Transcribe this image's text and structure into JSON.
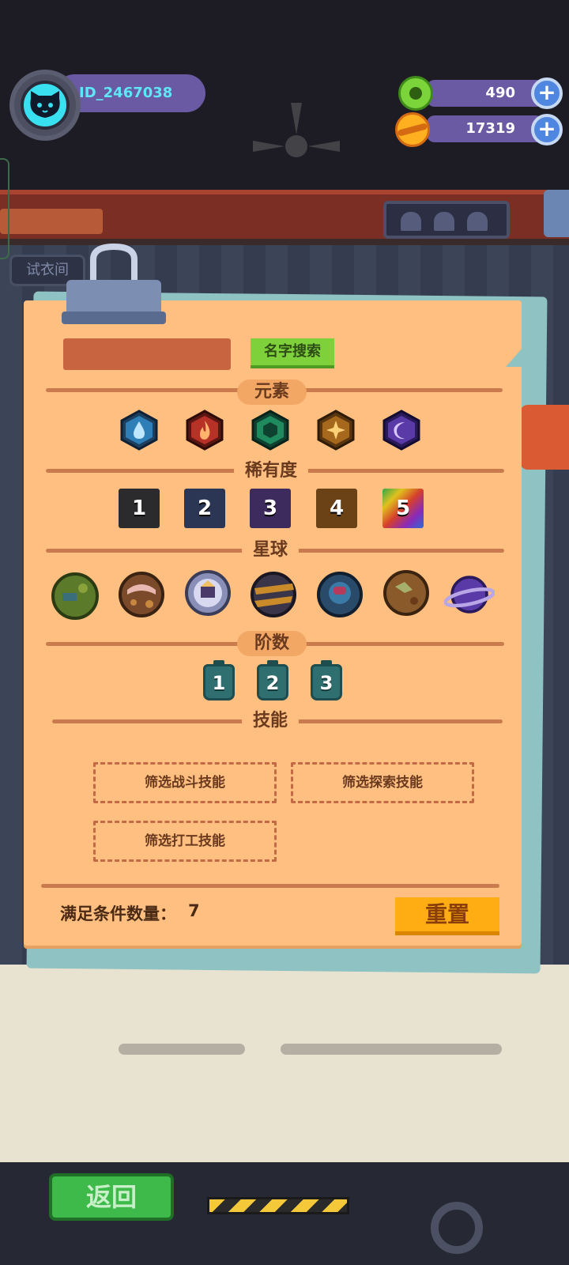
{
  "hud": {
    "player_id": "ID_2467038",
    "currency_green": "490",
    "currency_gold": "17319",
    "back_tab_label": "试衣间"
  },
  "panel": {
    "search_button": "名字搜索",
    "sections": {
      "element": "元素",
      "rarity": "稀有度",
      "planet": "星球",
      "tier": "阶数",
      "skill": "技能"
    },
    "elements": [
      {
        "name": "water",
        "color": "#2e7fb8"
      },
      {
        "name": "fire",
        "color": "#b83127"
      },
      {
        "name": "nature",
        "color": "#1f8a5e"
      },
      {
        "name": "light",
        "color": "#a5681c"
      },
      {
        "name": "dark",
        "color": "#5a3aa6"
      }
    ],
    "rarities": [
      "1",
      "2",
      "3",
      "4",
      "5"
    ],
    "rarity_colors": [
      "#2b2b2e",
      "#2a3654",
      "#3e2b5e",
      "#6a4215",
      "rainbow"
    ],
    "planets": [
      "planet-green",
      "planet-brown",
      "planet-castle",
      "planet-striped",
      "planet-blue",
      "planet-rocky",
      "planet-purple"
    ],
    "tiers": [
      "1",
      "2",
      "3"
    ],
    "skill_filters": {
      "battle": "筛选战斗技能",
      "explore": "筛选探索技能",
      "work": "筛选打工技能"
    },
    "match_count_label": "满足条件数量：",
    "match_count": "7",
    "reset_button": "重置"
  },
  "footer": {
    "return_button": "返回"
  }
}
